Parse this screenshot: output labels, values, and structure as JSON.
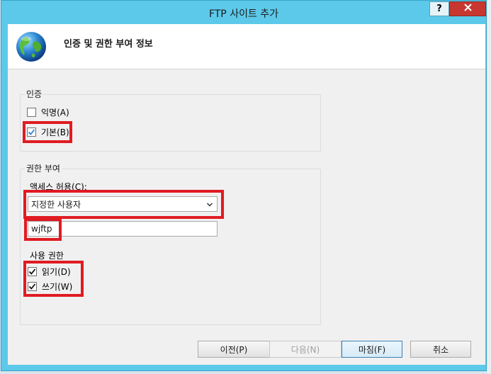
{
  "window": {
    "title": "FTP 사이트 추가",
    "help_label": "?",
    "close_label": "✕"
  },
  "header": {
    "title": "인증 및 권한 부여 정보",
    "icon": "globe-icon"
  },
  "auth": {
    "group_label": "인증",
    "anonymous": {
      "label": "익명(A)",
      "checked": false
    },
    "basic": {
      "label": "기본(B)",
      "checked": true
    }
  },
  "authorization": {
    "group_label": "권한 부여",
    "access_label": "액세스 허용(C):",
    "access_selected": "지정한 사용자",
    "user_value": "wjftp",
    "permissions_label": "사용 권한",
    "read": {
      "label": "읽기(D)",
      "checked": true
    },
    "write": {
      "label": "쓰기(W)",
      "checked": true
    }
  },
  "buttons": {
    "previous": "이전(P)",
    "next": "다음(N)",
    "finish": "마침(F)",
    "cancel": "취소"
  },
  "colors": {
    "highlight": "#e01b22",
    "titlebar": "#5cc9ea",
    "close": "#c7372f"
  }
}
